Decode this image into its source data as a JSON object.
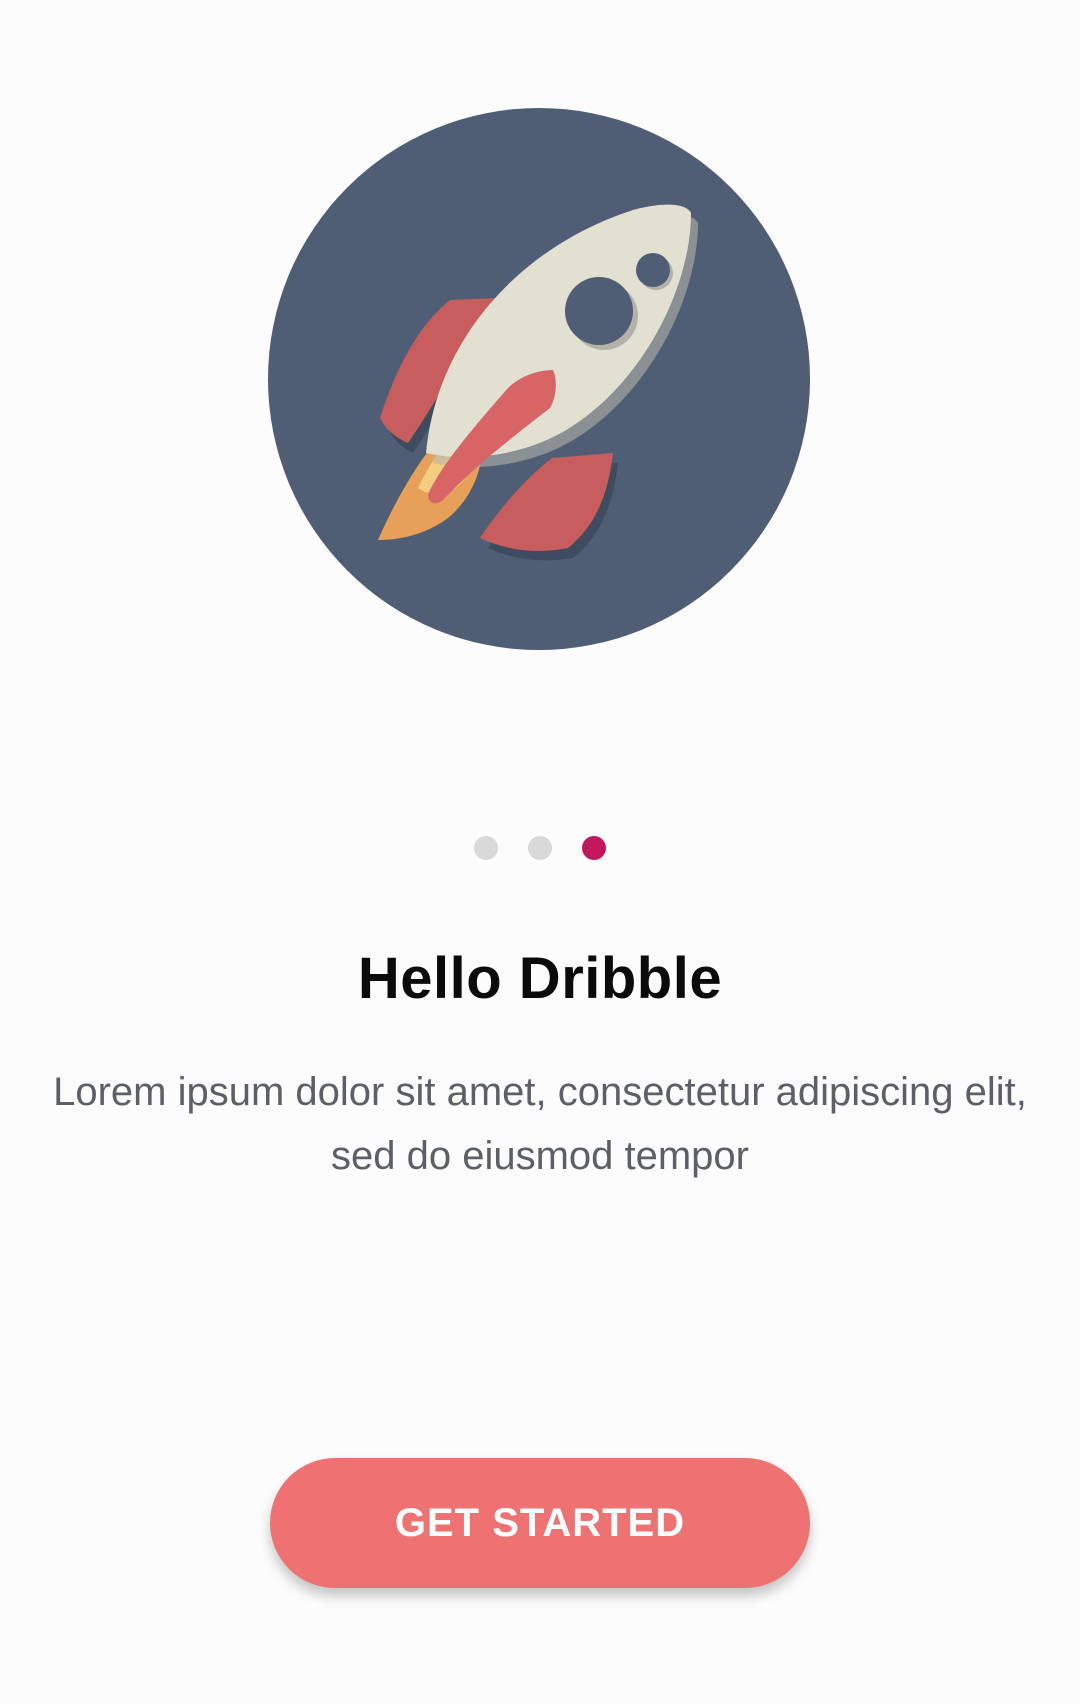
{
  "hero": {
    "icon": "rocket-icon",
    "background_color": "#4f5e74"
  },
  "pagination": {
    "total": 3,
    "active_index": 2,
    "active_color": "#c2185b",
    "inactive_color": "#d9d9d9"
  },
  "content": {
    "title": "Hello Dribble",
    "description": "Lorem ipsum dolor sit amet, consectetur adipiscing elit, sed do eiusmod tempor"
  },
  "cta": {
    "label": "GET STARTED",
    "color": "#ee7271"
  }
}
